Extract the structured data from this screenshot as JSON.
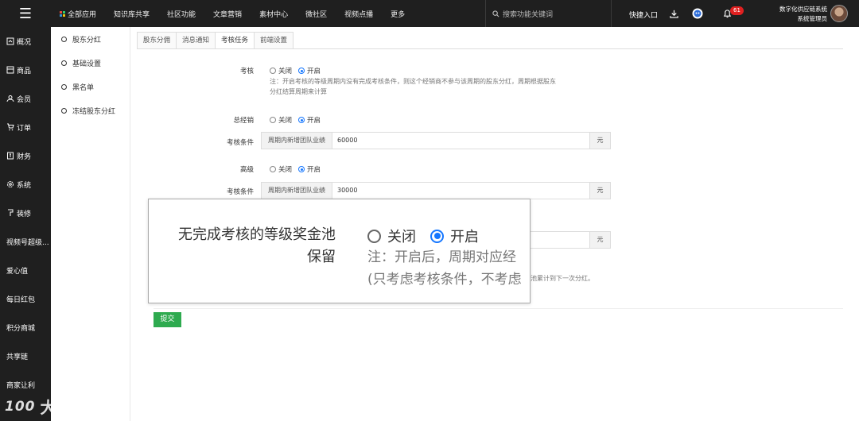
{
  "topbar": {
    "nav": [
      "全部应用",
      "知识库共享",
      "社区功能",
      "文章营销",
      "素材中心",
      "微社区",
      "视频点播",
      "更多"
    ],
    "search_placeholder": "搜索功能关键词",
    "quick_entry": "快捷入口",
    "notification_count": "61",
    "user_system": "数字化供应链系统",
    "user_role": "系统管理员"
  },
  "sidebar": [
    "概况",
    "商品",
    "会员",
    "订单",
    "财务",
    "系统",
    "装修",
    "视频号超级...",
    "爱心值",
    "每日红包",
    "积分商城",
    "共享链",
    "商家让利"
  ],
  "subnav": [
    "股东分红",
    "基础设置",
    "黑名单",
    "冻结股东分红"
  ],
  "tabs": [
    "股东分佣",
    "消息通知",
    "考核任务",
    "前端设置"
  ],
  "active_tab": "考核任务",
  "form": {
    "assess_label": "考核",
    "off": "关闭",
    "on": "开启",
    "note1": "注：开启考核的等级周期内没有完成考核条件，则这个经销商不参与该周期的股东分红，周期根据股东",
    "note2": "分红结算周期来计算",
    "level1_label": "总经销",
    "cond_label": "考核条件",
    "cond_prefix": "周期内新增团队业绩",
    "level1_value": "60000",
    "unit": "元",
    "level2_label": "高级",
    "level2_value": "30000",
    "behind_note": "池累计到下一次分红。",
    "submit": "提交"
  },
  "callout": {
    "label": "无完成考核的等级奖金池保留",
    "off": "关闭",
    "on": "开启",
    "note1": "注：开启后，周期对应经",
    "note2": "(只考虑考核条件，不考虑"
  },
  "watermark": "大数跨境",
  "watermark_logo": "100",
  "colors": {
    "accent": "#1677ff",
    "submit": "#2eaa4f",
    "topbar": "#1f1f1f",
    "badge": "#e02020"
  }
}
